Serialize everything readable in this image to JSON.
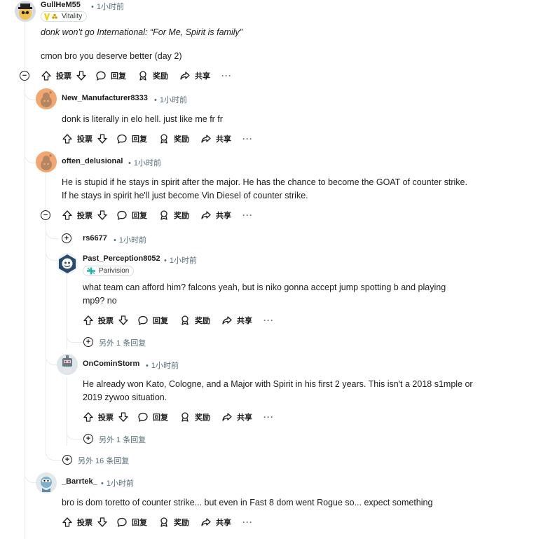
{
  "actions": {
    "upvote": "投票",
    "reply": "回复",
    "award": "奖励",
    "share": "共享",
    "more": "···"
  },
  "comments": [
    {
      "author": "GullHeM55",
      "time": "1小时前",
      "flair": "Vitality",
      "body": [
        "donk won't go International: “For Me, Spirit is family”",
        "cmon bro you deserve better (day 2)"
      ]
    },
    {
      "author": "New_Manufacturer8333",
      "time": "1小时前",
      "body": [
        "donk is literally in elo hell. just like me fr fr"
      ]
    },
    {
      "author": "often_delusional",
      "time": "1小时前",
      "body": [
        "He is stupid if he stays in spirit after the major. He has the chance to become the GOAT of counter strike.",
        "If he stays in spirit he'll just become Vin Diesel of counter strike."
      ]
    },
    {
      "author": "rs6677",
      "time": "1小时前"
    },
    {
      "author": "Past_Perception8052",
      "time": "1小时前",
      "flair": "Parivision",
      "body": [
        "what team can afford him? falcons yeah, but is niko gonna accept jump spotting b and playing",
        "mp9? no"
      ],
      "more_replies": "另外 1 条回复"
    },
    {
      "author": "OnCominStorm",
      "time": "1小时前",
      "body": [
        "He already won Kato, Cologne, and a Major with Spirit in his first 2 years. This isn't a 2018 s1mple or",
        "2019 zywoo situation."
      ],
      "more_replies": "另外 1 条回复"
    },
    {
      "author": "_Barrtek_",
      "time": "1小时前",
      "body": [
        "bro is dom toretto of counter strike... but even in Fast 8 dom went Rogue so... expect something"
      ]
    }
  ],
  "thread_more_replies": "另外 16 条回复",
  "colors": {
    "accent": "#0079d3",
    "meta": "#576f76",
    "line": "#e5ebee"
  }
}
